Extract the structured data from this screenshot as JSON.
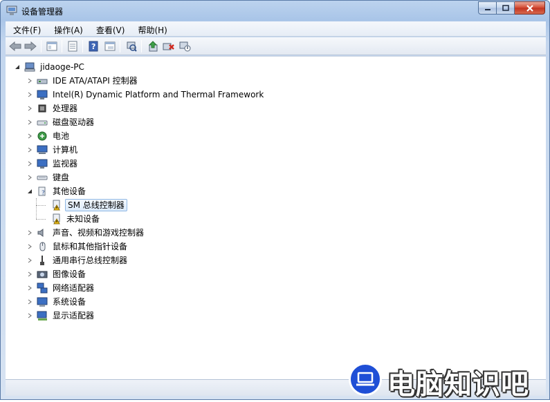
{
  "window": {
    "title": "设备管理器"
  },
  "menu": [
    "文件(F)",
    "操作(A)",
    "查看(V)",
    "帮助(H)"
  ],
  "toolbar_icons": [
    "back-icon",
    "forward-icon",
    "properties-pane-icon",
    "device-list-icon",
    "help-icon",
    "show-hidden-icon",
    "scan-hardware-icon",
    "update-driver-icon",
    "uninstall-icon",
    "disable-icon"
  ],
  "tree": {
    "root": "jidaoge-PC",
    "categories": [
      {
        "label": "IDE ATA/ATAPI 控制器",
        "icon": "ide-controller-icon"
      },
      {
        "label": "Intel(R) Dynamic Platform and Thermal Framework",
        "icon": "monitor-icon"
      },
      {
        "label": "处理器",
        "icon": "processor-icon"
      },
      {
        "label": "磁盘驱动器",
        "icon": "disk-drive-icon"
      },
      {
        "label": "电池",
        "icon": "battery-icon"
      },
      {
        "label": "计算机",
        "icon": "computer-icon"
      },
      {
        "label": "监视器",
        "icon": "monitor-icon"
      },
      {
        "label": "键盘",
        "icon": "keyboard-icon"
      },
      {
        "label": "其他设备",
        "icon": "unknown-device-icon",
        "expanded": true,
        "children": [
          {
            "label": "SM 总线控制器",
            "icon": "warning-device-icon",
            "selected": true
          },
          {
            "label": "未知设备",
            "icon": "warning-device-icon"
          }
        ]
      },
      {
        "label": "声音、视频和游戏控制器",
        "icon": "sound-icon"
      },
      {
        "label": "鼠标和其他指针设备",
        "icon": "mouse-icon"
      },
      {
        "label": "通用串行总线控制器",
        "icon": "usb-icon"
      },
      {
        "label": "图像设备",
        "icon": "camera-icon"
      },
      {
        "label": "网络适配器",
        "icon": "network-icon"
      },
      {
        "label": "系统设备",
        "icon": "system-device-icon"
      },
      {
        "label": "显示适配器",
        "icon": "display-adapter-icon"
      }
    ]
  },
  "watermark": {
    "text": "电脑知识吧"
  }
}
